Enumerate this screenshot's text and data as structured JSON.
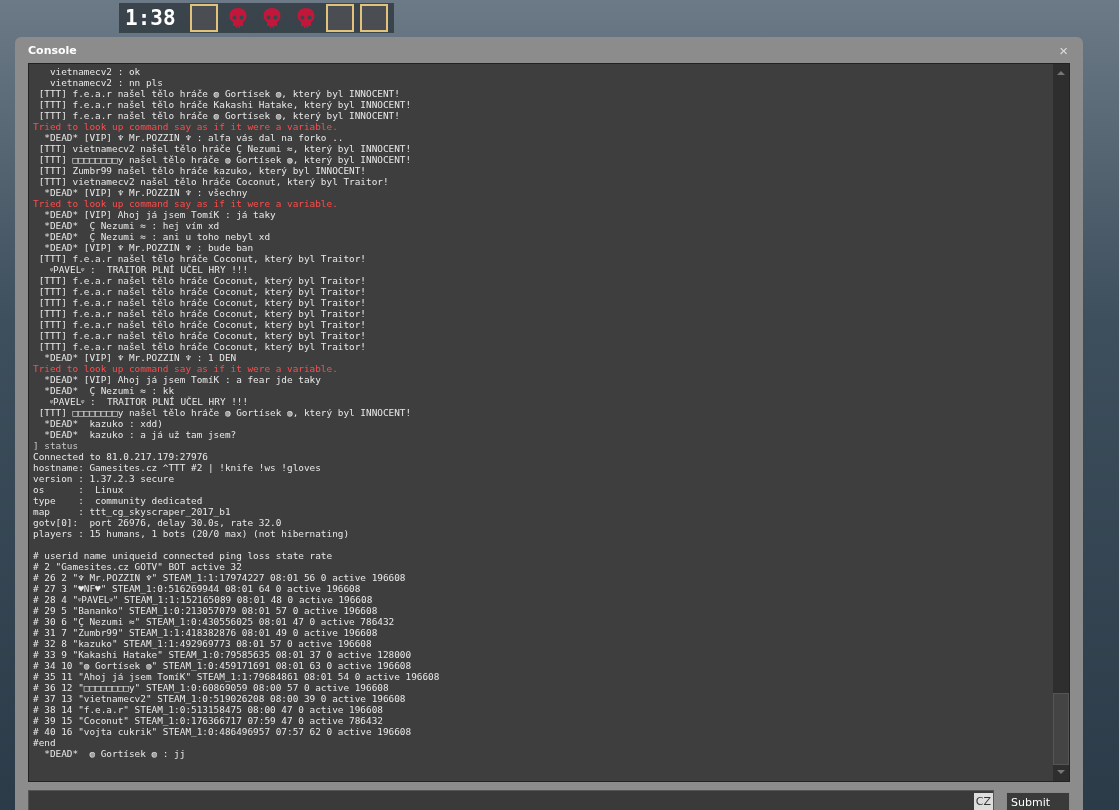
{
  "hud": {
    "timer": "1:38",
    "slots": [
      {
        "kind": "avatar"
      },
      {
        "kind": "skull"
      },
      {
        "kind": "skull"
      },
      {
        "kind": "skull"
      },
      {
        "kind": "avatar"
      },
      {
        "kind": "avatar"
      }
    ]
  },
  "window": {
    "title": "Console",
    "close": "×"
  },
  "console": {
    "lines": [
      {
        "kind": "normal",
        "text": "   vietnamecv2 : ok"
      },
      {
        "kind": "normal",
        "text": "   vietnamecv2 : nn pls"
      },
      {
        "kind": "normal",
        "text": " [TTT] f.e.a.r našel tělo hráče ◍ Gortísek ◍, který byl INNOCENT!"
      },
      {
        "kind": "normal",
        "text": " [TTT] f.e.a.r našel tělo hráče Kakashi Hatake, který byl INNOCENT!"
      },
      {
        "kind": "normal",
        "text": " [TTT] f.e.a.r našel tělo hráče ◍ Gortísek ◍, který byl INNOCENT!"
      },
      {
        "kind": "error",
        "text": "Tried to look up command say as if it were a variable."
      },
      {
        "kind": "normal",
        "text": "  *DEAD* [VIP] ♆ Mr.POZZIN ♆ : alfa vás dal na forko .."
      },
      {
        "kind": "normal",
        "text": " [TTT] vietnamecv2 našel tělo hráče Ç Nezumi ≈, který byl INNOCENT!"
      },
      {
        "kind": "normal",
        "text": " [TTT] □□□□□□□□y našel tělo hráče ◍ Gortísek ◍, který byl INNOCENT!"
      },
      {
        "kind": "normal",
        "text": " [TTT] Zumbr99 našel tělo hráče kazuko, který byl INNOCENT!"
      },
      {
        "kind": "normal",
        "text": " [TTT] vietnamecv2 našel tělo hráče Coconut, který byl Traitor!"
      },
      {
        "kind": "normal",
        "text": "  *DEAD* [VIP] ♆ Mr.POZZIN ♆ : všechny"
      },
      {
        "kind": "error",
        "text": "Tried to look up command say as if it were a variable."
      },
      {
        "kind": "normal",
        "text": "  *DEAD* [VIP] Ahoj já jsem TomíK : já taky"
      },
      {
        "kind": "normal",
        "text": "  *DEAD*  Ç Nezumi ≈ : hej vím xd"
      },
      {
        "kind": "normal",
        "text": "  *DEAD*  Ç Nezumi ≈ : ani u toho nebyl xd"
      },
      {
        "kind": "normal",
        "text": "  *DEAD* [VIP] ♆ Mr.POZZIN ♆ : bude ban"
      },
      {
        "kind": "normal",
        "text": " [TTT] f.e.a.r našel tělo hráče Coconut, který byl Traitor!"
      },
      {
        "kind": "normal",
        "text": "   ᵠPAVELᵠ :  TRAITOR PLNÍ UČEL HRY !!!"
      },
      {
        "kind": "normal",
        "text": " [TTT] f.e.a.r našel tělo hráče Coconut, který byl Traitor!"
      },
      {
        "kind": "normal",
        "text": " [TTT] f.e.a.r našel tělo hráče Coconut, který byl Traitor!"
      },
      {
        "kind": "normal",
        "text": " [TTT] f.e.a.r našel tělo hráče Coconut, který byl Traitor!"
      },
      {
        "kind": "normal",
        "text": " [TTT] f.e.a.r našel tělo hráče Coconut, který byl Traitor!"
      },
      {
        "kind": "normal",
        "text": " [TTT] f.e.a.r našel tělo hráče Coconut, který byl Traitor!"
      },
      {
        "kind": "normal",
        "text": " [TTT] f.e.a.r našel tělo hráče Coconut, který byl Traitor!"
      },
      {
        "kind": "normal",
        "text": " [TTT] f.e.a.r našel tělo hráče Coconut, který byl Traitor!"
      },
      {
        "kind": "normal",
        "text": "  *DEAD* [VIP] ♆ Mr.POZZIN ♆ : 1 DEN"
      },
      {
        "kind": "error",
        "text": "Tried to look up command say as if it were a variable."
      },
      {
        "kind": "normal",
        "text": "  *DEAD* [VIP] Ahoj já jsem TomíK : a fear jde taky"
      },
      {
        "kind": "normal",
        "text": "  *DEAD*  Ç Nezumi ≈ : kk"
      },
      {
        "kind": "normal",
        "text": "   ᵠPAVELᵠ :  TRAITOR PLNÍ UČEL HRY !!!"
      },
      {
        "kind": "normal",
        "text": " [TTT] □□□□□□□□y našel tělo hráče ◍ Gortísek ◍, který byl INNOCENT!"
      },
      {
        "kind": "normal",
        "text": "  *DEAD*  kazuko : xdd)"
      },
      {
        "kind": "normal",
        "text": "  *DEAD*  kazuko : a já už tam jsem?"
      },
      {
        "kind": "command",
        "text": "] status"
      },
      {
        "kind": "normal",
        "text": "Connected to 81.0.217.179:27976"
      },
      {
        "kind": "normal",
        "text": "hostname: Gamesites.cz ^TTT #2 | !knife !ws !gloves"
      },
      {
        "kind": "normal",
        "text": "version : 1.37.2.3 secure"
      },
      {
        "kind": "normal",
        "text": "os      :  Linux"
      },
      {
        "kind": "normal",
        "text": "type    :  community dedicated"
      },
      {
        "kind": "normal",
        "text": "map     : ttt_cg_skyscraper_2017_b1"
      },
      {
        "kind": "normal",
        "text": "gotv[0]:  port 26976, delay 30.0s, rate 32.0"
      },
      {
        "kind": "normal",
        "text": "players : 15 humans, 1 bots (20/0 max) (not hibernating)"
      },
      {
        "kind": "blank"
      },
      {
        "kind": "normal",
        "text": "# userid name uniqueid connected ping loss state rate"
      },
      {
        "kind": "normal",
        "text": "# 2 \"Gamesites.cz GOTV\" BOT active 32"
      },
      {
        "kind": "normal",
        "text": "# 26 2 \"♆ Mr.POZZIN ♆\" STEAM_1:1:17974227 08:01 56 0 active 196608"
      },
      {
        "kind": "normal",
        "text": "# 27 3 \"♥NF♥\" STEAM_1:0:516269944 08:01 64 0 active 196608"
      },
      {
        "kind": "normal",
        "text": "# 28 4 \"ᵠPAVELᵠ\" STEAM_1:1:152165089 08:01 48 0 active 196608"
      },
      {
        "kind": "normal",
        "text": "# 29 5 \"Bananko\" STEAM_1:0:213057079 08:01 57 0 active 196608"
      },
      {
        "kind": "normal",
        "text": "# 30 6 \"Ç Nezumi ≈\" STEAM_1:0:430556025 08:01 47 0 active 786432"
      },
      {
        "kind": "normal",
        "text": "# 31 7 \"Zumbr99\" STEAM_1:1:418382876 08:01 49 0 active 196608"
      },
      {
        "kind": "normal",
        "text": "# 32 8 \"kazuko\" STEAM_1:1:492969773 08:01 57 0 active 196608"
      },
      {
        "kind": "normal",
        "text": "# 33 9 \"Kakashi Hatake\" STEAM_1:0:79585635 08:01 37 0 active 128000"
      },
      {
        "kind": "normal",
        "text": "# 34 10 \"◍ Gortísek ◍\" STEAM_1:0:459171691 08:01 63 0 active 196608"
      },
      {
        "kind": "normal",
        "text": "# 35 11 \"Ahoj já jsem TomíK\" STEAM_1:1:79684861 08:01 54 0 active 196608"
      },
      {
        "kind": "normal",
        "text": "# 36 12 \"□□□□□□□□y\" STEAM_1:0:60869059 08:00 57 0 active 196608"
      },
      {
        "kind": "normal",
        "text": "# 37 13 \"vietnamecv2\" STEAM_1:0:519026208 08:00 39 0 active 196608"
      },
      {
        "kind": "normal",
        "text": "# 38 14 \"f.e.a.r\" STEAM_1:0:513158475 08:00 47 0 active 196608"
      },
      {
        "kind": "normal",
        "text": "# 39 15 \"Coconut\" STEAM_1:0:176366717 07:59 47 0 active 786432"
      },
      {
        "kind": "normal",
        "text": "# 40 16 \"vojta cukrik\" STEAM_1:0:486496957 07:57 62 0 active 196608"
      },
      {
        "kind": "normal",
        "text": "#end"
      },
      {
        "kind": "normal",
        "text": "  *DEAD*  ◍ Gortísek ◍ : jj"
      }
    ]
  },
  "input": {
    "language": "CZ",
    "submit": "Submit"
  }
}
